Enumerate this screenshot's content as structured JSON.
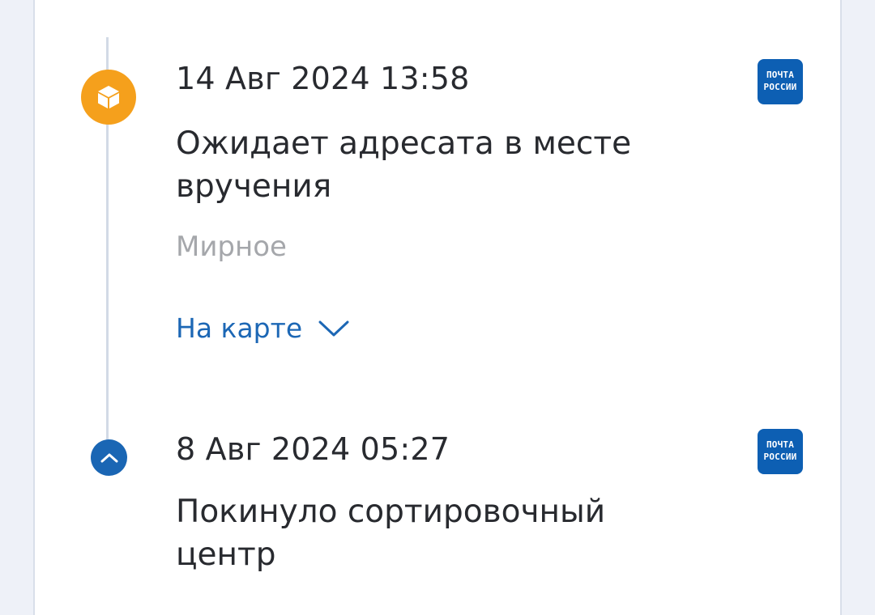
{
  "events": [
    {
      "date": "14 Авг 2024 13:58",
      "status": "Ожидает адресата в месте вручения",
      "place": "Мирное",
      "map_label": "На карте",
      "logo_line1": "ПОЧТА",
      "logo_line2": "РОССИИ",
      "icon_color": "#f5a01c"
    },
    {
      "date": "8 Авг 2024 05:27",
      "status": "Покинуло сортировочный центр",
      "logo_line1": "ПОЧТА",
      "logo_line2": "РОССИИ",
      "icon_color": "#1a66b4"
    }
  ],
  "colors": {
    "accent": "#1c67b5",
    "brand_logo": "#0d5fb3",
    "timeline": "#d2dae6",
    "muted_text": "#a5a7ab"
  }
}
